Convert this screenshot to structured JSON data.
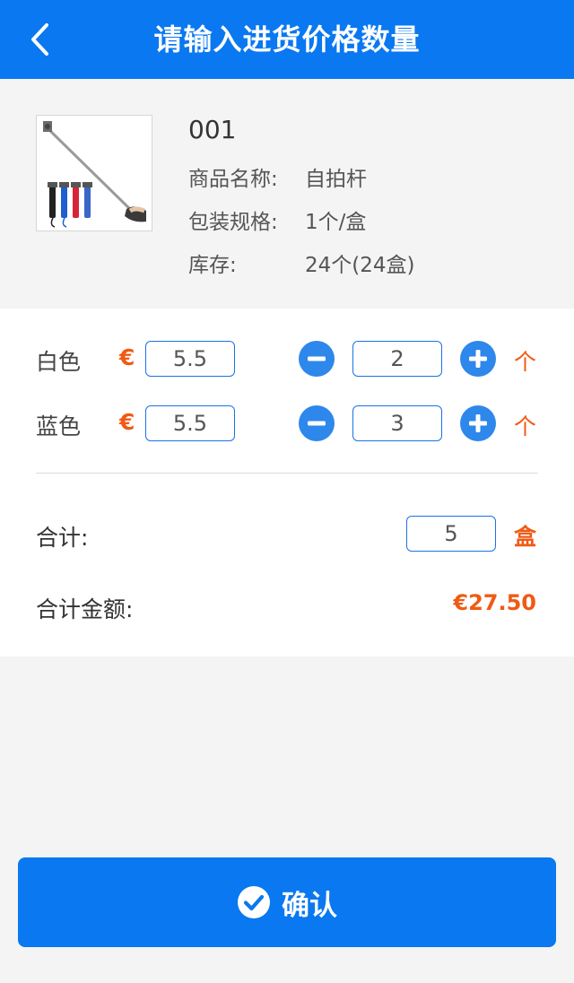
{
  "header": {
    "title": "请输入进货价格数量",
    "back_icon": "chevron-left-icon"
  },
  "product": {
    "code": "001",
    "name_label": "商品名称:",
    "name_value": "自拍杆",
    "spec_label": "包装规格:",
    "spec_value": "1个/盒",
    "stock_label": "库存:",
    "stock_value": "24个(24盒)"
  },
  "variants": [
    {
      "color": "白色",
      "currency": "€",
      "price": "5.5",
      "qty": "2",
      "unit": "个"
    },
    {
      "color": "蓝色",
      "currency": "€",
      "price": "5.5",
      "qty": "3",
      "unit": "个"
    }
  ],
  "summary": {
    "total_label": "合计:",
    "total_qty": "5",
    "total_unit": "盒",
    "amount_label": "合计金额:",
    "amount_value": "€27.50"
  },
  "confirm": {
    "label": "确认",
    "icon": "check-circle-icon"
  },
  "colors": {
    "primary": "#0a78f0",
    "accent": "#f05a14",
    "button": "#2e87ea"
  }
}
